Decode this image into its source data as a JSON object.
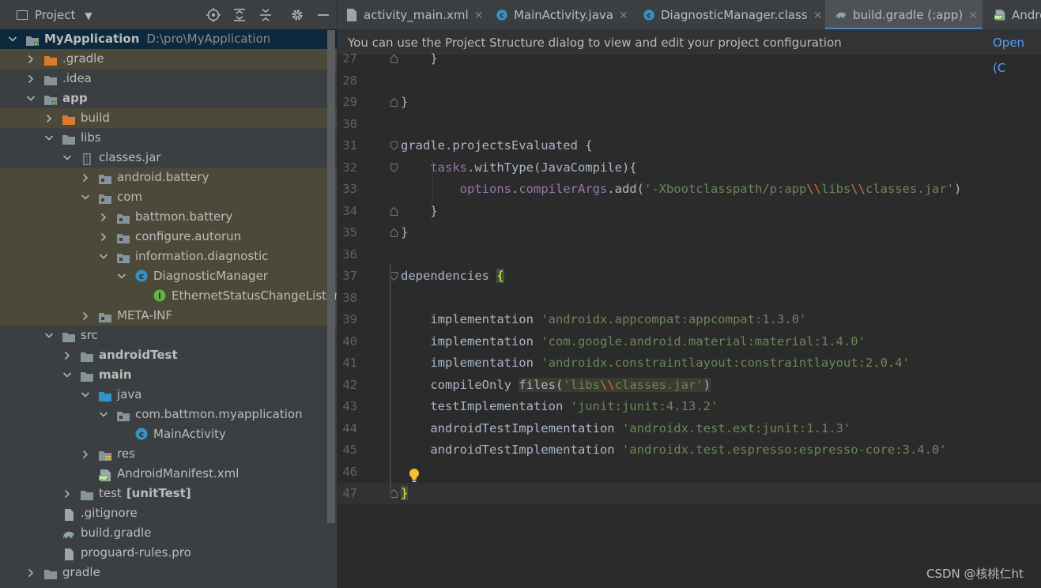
{
  "project_panel": {
    "title": "Project",
    "tree": [
      {
        "label": "MyApplication",
        "path": "D:\\pro\\MyApplication",
        "bold": true,
        "depth": 0,
        "arrow": "down",
        "icon": "module-folder-icon",
        "style": "sel"
      },
      {
        "label": ".gradle",
        "depth": 1,
        "arrow": "right",
        "icon": "folder-orange-icon",
        "style": "excl"
      },
      {
        "label": ".idea",
        "depth": 1,
        "arrow": "right",
        "icon": "folder-icon"
      },
      {
        "label": "app",
        "bold": true,
        "depth": 1,
        "arrow": "down",
        "icon": "module-folder-icon"
      },
      {
        "label": "build",
        "depth": 2,
        "arrow": "right",
        "icon": "folder-orange-icon",
        "style": "excl"
      },
      {
        "label": "libs",
        "depth": 2,
        "arrow": "down",
        "icon": "folder-icon"
      },
      {
        "label": "classes.jar",
        "depth": 3,
        "arrow": "down",
        "icon": "jar-icon"
      },
      {
        "label": "android.battery",
        "depth": 4,
        "arrow": "right",
        "icon": "package-icon",
        "style": "excl"
      },
      {
        "label": "com",
        "depth": 4,
        "arrow": "down",
        "icon": "package-icon",
        "style": "excl"
      },
      {
        "label": "battmon.battery",
        "depth": 5,
        "arrow": "right",
        "icon": "package-icon",
        "style": "excl"
      },
      {
        "label": "configure.autorun",
        "depth": 5,
        "arrow": "right",
        "icon": "package-icon",
        "style": "excl"
      },
      {
        "label": "information.diagnostic",
        "depth": 5,
        "arrow": "down",
        "icon": "package-icon",
        "style": "excl"
      },
      {
        "label": "DiagnosticManager",
        "depth": 6,
        "arrow": "down",
        "icon": "class-icon",
        "style": "excl"
      },
      {
        "label": "EthernetStatusChangeListene",
        "depth": 7,
        "arrow": "none",
        "icon": "interface-icon",
        "style": "excl"
      },
      {
        "label": "META-INF",
        "depth": 4,
        "arrow": "right",
        "icon": "package-icon",
        "style": "excl"
      },
      {
        "label": "src",
        "depth": 2,
        "arrow": "down",
        "icon": "folder-icon"
      },
      {
        "label": "androidTest",
        "bold": true,
        "depth": 3,
        "arrow": "right",
        "icon": "folder-icon"
      },
      {
        "label": "main",
        "bold": true,
        "depth": 3,
        "arrow": "down",
        "icon": "folder-icon"
      },
      {
        "label": "java",
        "depth": 4,
        "arrow": "down",
        "icon": "source-folder-icon"
      },
      {
        "label": "com.battmon.myapplication",
        "depth": 5,
        "arrow": "down",
        "icon": "package-icon"
      },
      {
        "label": "MainActivity",
        "depth": 6,
        "arrow": "none",
        "icon": "class-icon"
      },
      {
        "label": "res",
        "depth": 4,
        "arrow": "right",
        "icon": "resources-folder-icon"
      },
      {
        "label": "AndroidManifest.xml",
        "depth": 4,
        "arrow": "none",
        "icon": "manifest-icon"
      },
      {
        "label": "test",
        "suffix": "[unitTest]",
        "depth": 3,
        "arrow": "right",
        "icon": "folder-icon"
      },
      {
        "label": ".gitignore",
        "depth": 2,
        "arrow": "none",
        "icon": "file-icon"
      },
      {
        "label": "build.gradle",
        "depth": 2,
        "arrow": "none",
        "icon": "gradle-icon"
      },
      {
        "label": "proguard-rules.pro",
        "depth": 2,
        "arrow": "none",
        "icon": "file-icon"
      },
      {
        "label": "gradle",
        "depth": 1,
        "arrow": "right",
        "icon": "folder-icon"
      }
    ]
  },
  "tabs": [
    {
      "label": "activity_main.xml",
      "icon": "xml-icon",
      "active": false,
      "closable": true
    },
    {
      "label": "MainActivity.java",
      "icon": "class-icon",
      "active": false,
      "closable": true
    },
    {
      "label": "DiagnosticManager.class",
      "icon": "class-icon",
      "active": false,
      "closable": true
    },
    {
      "label": "build.gradle (:app)",
      "icon": "gradle-icon",
      "active": true,
      "closable": true
    },
    {
      "label": "Andro",
      "icon": "manifest-icon",
      "active": false,
      "closable": false
    }
  ],
  "banner": {
    "message": "You can use the Project Structure dialog to view and edit your project configuration",
    "link": "Open (C"
  },
  "code_lines": [
    {
      "num": "27",
      "text": "    }"
    },
    {
      "num": "28",
      "text": ""
    },
    {
      "num": "29",
      "text": "}"
    },
    {
      "num": "30",
      "text": ""
    },
    {
      "num": "31",
      "text": "gradle.projectsEvaluated {"
    },
    {
      "num": "32",
      "text": "    tasks.withType(JavaCompile){"
    },
    {
      "num": "33",
      "text": "        options.compilerArgs.add('-Xbootclasspath/p:app\\\\libs\\\\classes.jar')"
    },
    {
      "num": "34",
      "text": "    }"
    },
    {
      "num": "35",
      "text": "}"
    },
    {
      "num": "36",
      "text": ""
    },
    {
      "num": "37",
      "text": "dependencies {"
    },
    {
      "num": "38",
      "text": ""
    },
    {
      "num": "39",
      "text": "    implementation 'androidx.appcompat:appcompat:1.3.0'"
    },
    {
      "num": "40",
      "text": "    implementation 'com.google.android.material:material:1.4.0'"
    },
    {
      "num": "41",
      "text": "    implementation 'androidx.constraintlayout:constraintlayout:2.0.4'"
    },
    {
      "num": "42",
      "text": "    compileOnly files('libs\\\\classes.jar')"
    },
    {
      "num": "43",
      "text": "    testImplementation 'junit:junit:4.13.2'"
    },
    {
      "num": "44",
      "text": "    androidTestImplementation 'androidx.test.ext:junit:1.1.3'"
    },
    {
      "num": "45",
      "text": "    androidTestImplementation 'androidx.test.espresso:espresso-core:3.4.0'"
    },
    {
      "num": "46",
      "text": ""
    },
    {
      "num": "47",
      "text": "}"
    }
  ],
  "watermark": "CSDN @核桃仁ht",
  "colors": {
    "keyword": "#cc7832",
    "string": "#6a8759",
    "property": "#9876aa",
    "link": "#589df6",
    "accent": "#4a88c7"
  }
}
